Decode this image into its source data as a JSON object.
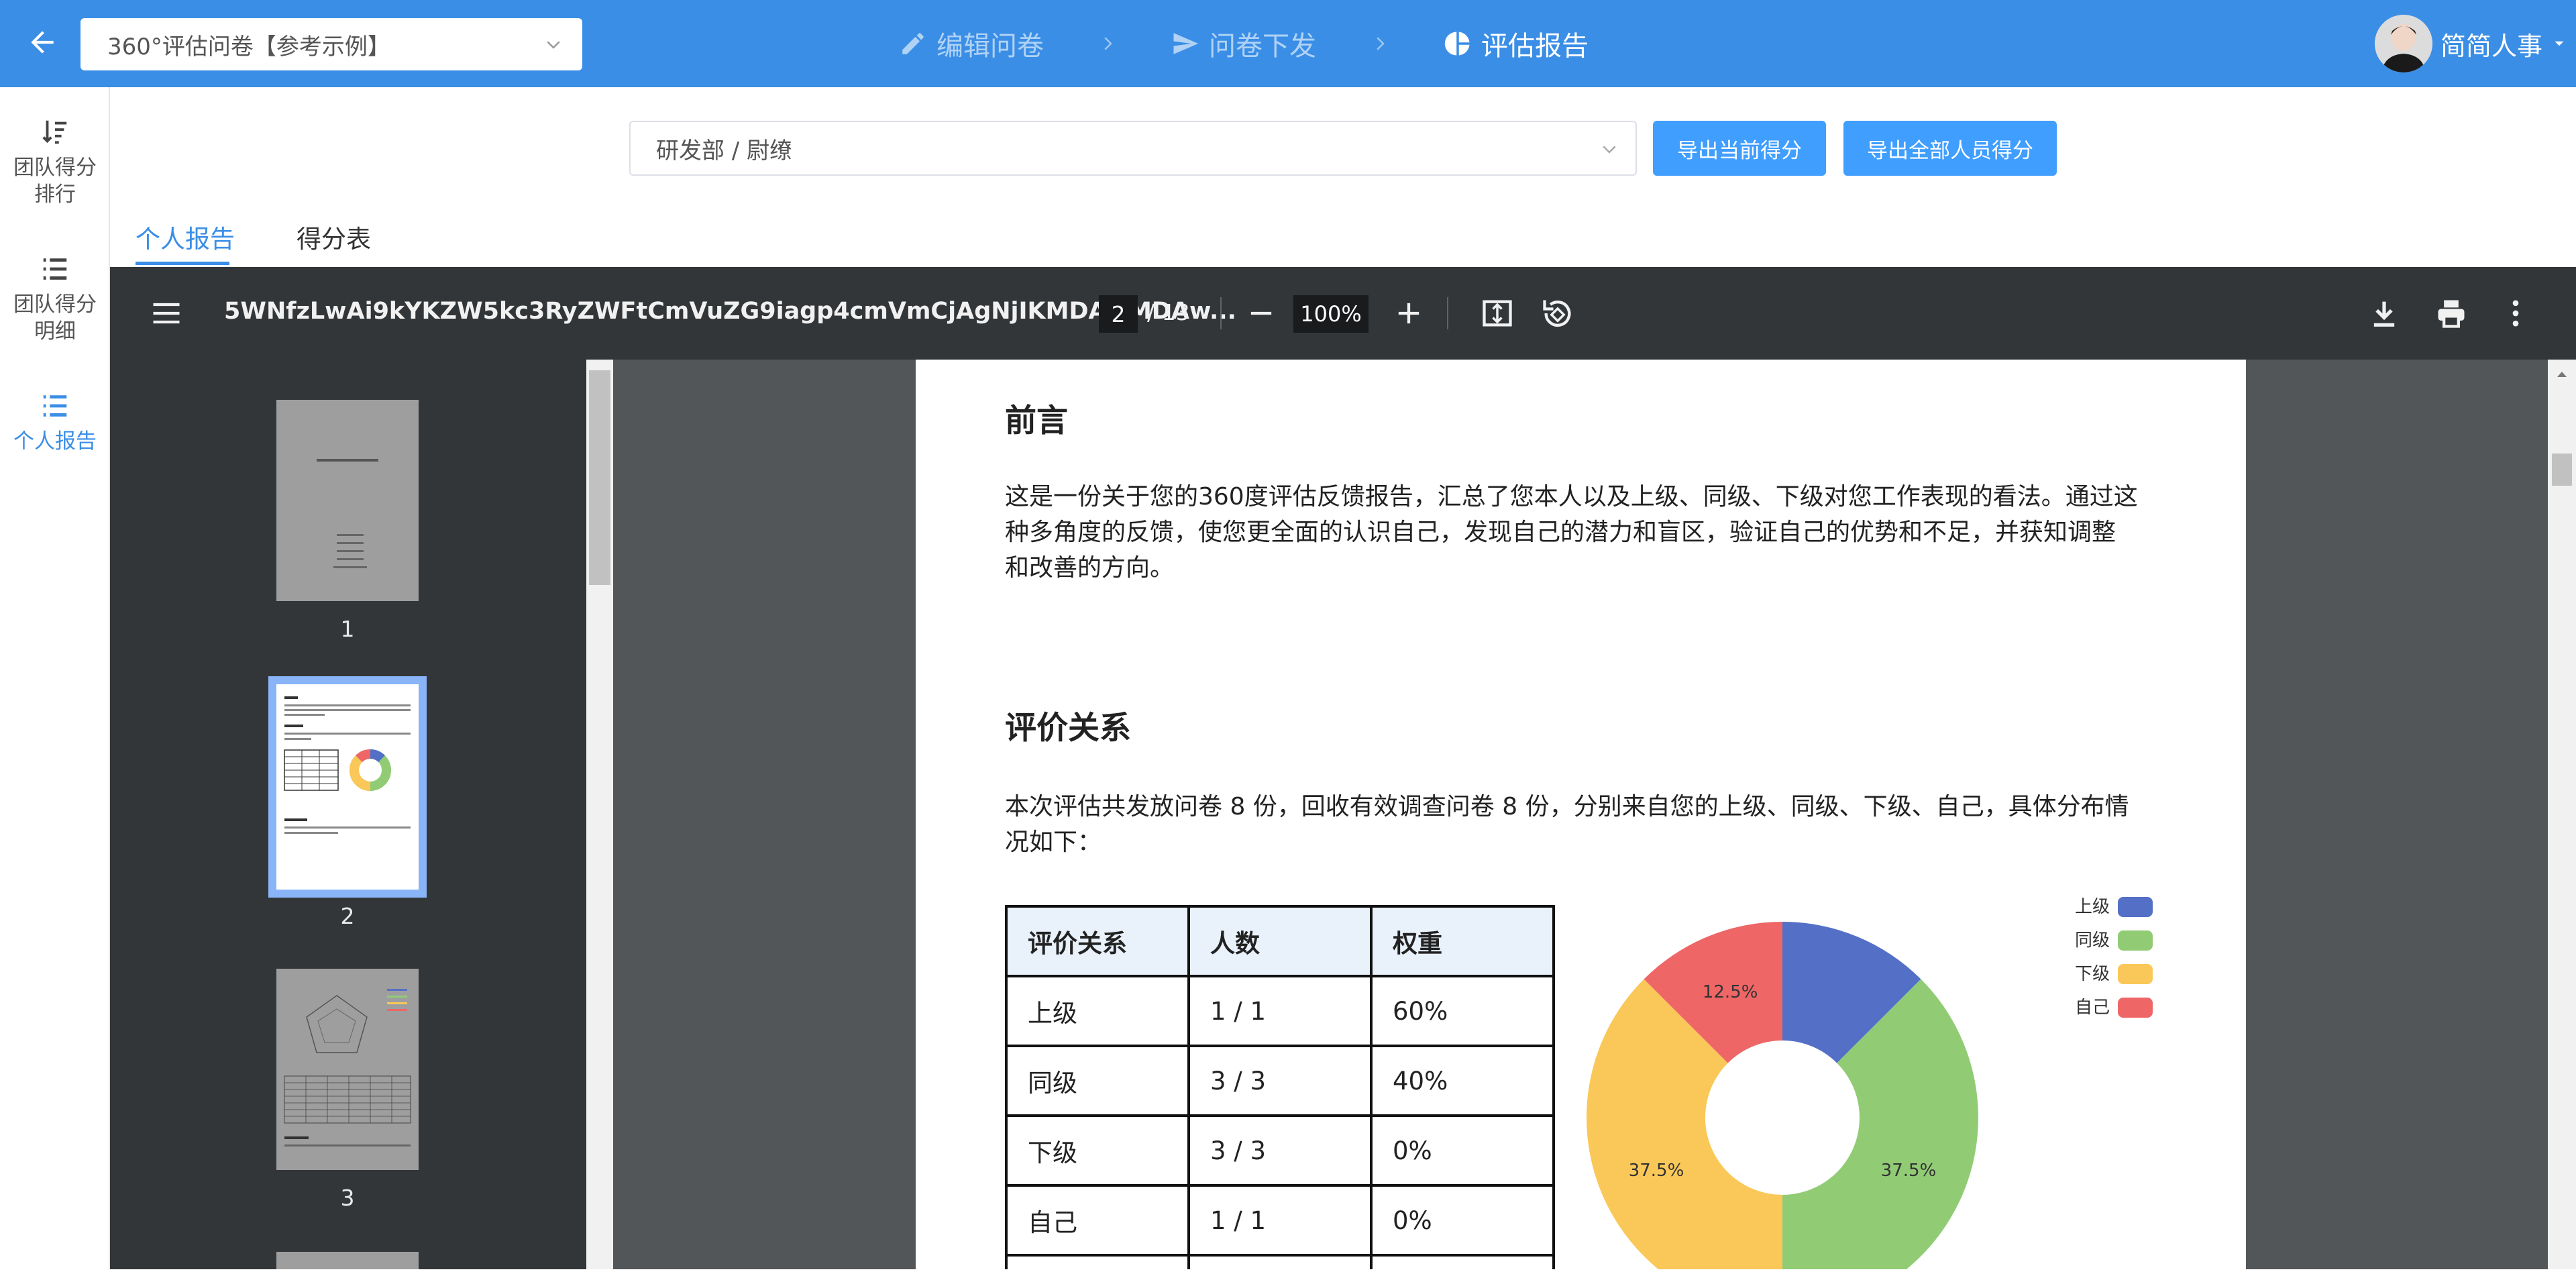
{
  "header": {
    "survey_select": "360°评估问卷【参考示例】",
    "steps": [
      {
        "label": "编辑问卷",
        "icon": "pencil-icon"
      },
      {
        "label": "问卷下发",
        "icon": "send-icon"
      },
      {
        "label": "评估报告",
        "icon": "pie-chart-icon"
      }
    ],
    "user_name": "简简人事"
  },
  "sidebar": {
    "items": [
      {
        "label_1": "团队得分",
        "label_2": "排行",
        "icon": "sort-icon"
      },
      {
        "label_1": "团队得分",
        "label_2": "明细",
        "icon": "list-icon"
      },
      {
        "label_1": "个人报告",
        "icon": "list-icon"
      }
    ]
  },
  "filters": {
    "department": "研发部 / 尉缭",
    "export_current": "导出当前得分",
    "export_all": "导出全部人员得分"
  },
  "tabs": [
    "个人报告",
    "得分表"
  ],
  "viewer": {
    "file_name": "5WNfzLwAi9kYKZW5kc3RyZWFtCmVuZG9iagp4cmVmCjAgNjIKMDAwMDAw...",
    "page_current": "2",
    "page_total": "/ 13",
    "zoom": "100%",
    "thumb_numbers": [
      "1",
      "2",
      "3"
    ]
  },
  "page": {
    "section1_title": "前言",
    "section1_lines": [
      "这是一份关于您的360度评估反馈报告，汇总了您本人以及上级、同级、下级对您工作表现的看法。通过这",
      "种多角度的反馈，使您更全面的认识自己，发现自己的潜力和盲区，验证自己的优势和不足，并获知调整",
      "和改善的方向。"
    ],
    "section2_title": "评价关系",
    "section2_lines": [
      "本次评估共发放问卷 8 份，回收有效调查问卷 8 份，分别来自您的上级、同级、下级、自己，具体分布情",
      "况如下："
    ],
    "table": {
      "headers": [
        "评价关系",
        "人数",
        "权重"
      ],
      "rows": [
        [
          "上级",
          "1 / 1",
          "60%"
        ],
        [
          "同级",
          "3 / 3",
          "40%"
        ],
        [
          "下级",
          "3 / 3",
          "0%"
        ],
        [
          "自己",
          "1 / 1",
          "0%"
        ]
      ]
    }
  },
  "chart_data": {
    "type": "pie",
    "categories": [
      "上级",
      "同级",
      "下级",
      "自己"
    ],
    "values": [
      12.5,
      37.5,
      37.5,
      12.5
    ],
    "data_labels": [
      "",
      "37.5%",
      "37.5%",
      "12.5%"
    ],
    "colors": [
      "#5470c6",
      "#91cc75",
      "#fac858",
      "#ee6666"
    ],
    "donut": true,
    "legend_position": "top-right"
  }
}
